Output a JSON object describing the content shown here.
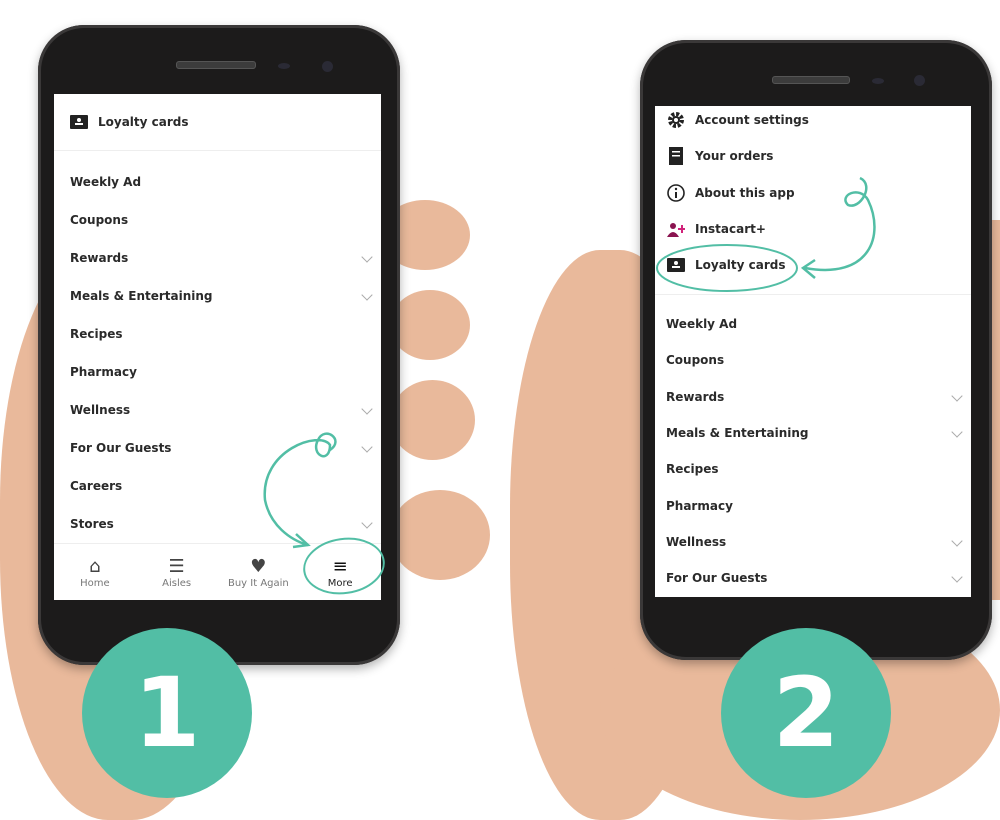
{
  "accent_color": "#52bea5",
  "step1": {
    "number": "1",
    "header_item": {
      "label": "Loyalty cards",
      "icon": "loyalty-card-icon"
    },
    "menu_items": [
      {
        "label": "Weekly Ad",
        "expandable": false
      },
      {
        "label": "Coupons",
        "expandable": false
      },
      {
        "label": "Rewards",
        "expandable": true
      },
      {
        "label": "Meals & Entertaining",
        "expandable": true
      },
      {
        "label": "Recipes",
        "expandable": false
      },
      {
        "label": "Pharmacy",
        "expandable": false
      },
      {
        "label": "Wellness",
        "expandable": true
      },
      {
        "label": "For Our Guests",
        "expandable": true
      },
      {
        "label": "Careers",
        "expandable": false
      },
      {
        "label": "Stores",
        "expandable": true
      }
    ],
    "bottom_nav": [
      {
        "label": "Home",
        "icon": "home-icon"
      },
      {
        "label": "Aisles",
        "icon": "list-icon"
      },
      {
        "label": "Buy It Again",
        "icon": "shopping-bag-heart-icon"
      },
      {
        "label": "More",
        "icon": "hamburger-menu-icon",
        "highlighted": true
      }
    ]
  },
  "step2": {
    "number": "2",
    "account_items": [
      {
        "label": "Account settings",
        "icon": "gear-icon"
      },
      {
        "label": "Your orders",
        "icon": "receipt-icon"
      },
      {
        "label": "About this app",
        "icon": "info-icon"
      },
      {
        "label": "Instacart+",
        "icon": "instacart-plus-icon"
      },
      {
        "label": "Loyalty cards",
        "icon": "loyalty-card-icon",
        "highlighted": true
      }
    ],
    "menu_items": [
      {
        "label": "Weekly Ad",
        "expandable": false
      },
      {
        "label": "Coupons",
        "expandable": false
      },
      {
        "label": "Rewards",
        "expandable": true
      },
      {
        "label": "Meals & Entertaining",
        "expandable": true
      },
      {
        "label": "Recipes",
        "expandable": false
      },
      {
        "label": "Pharmacy",
        "expandable": false
      },
      {
        "label": "Wellness",
        "expandable": true
      },
      {
        "label": "For Our Guests",
        "expandable": true
      }
    ]
  }
}
